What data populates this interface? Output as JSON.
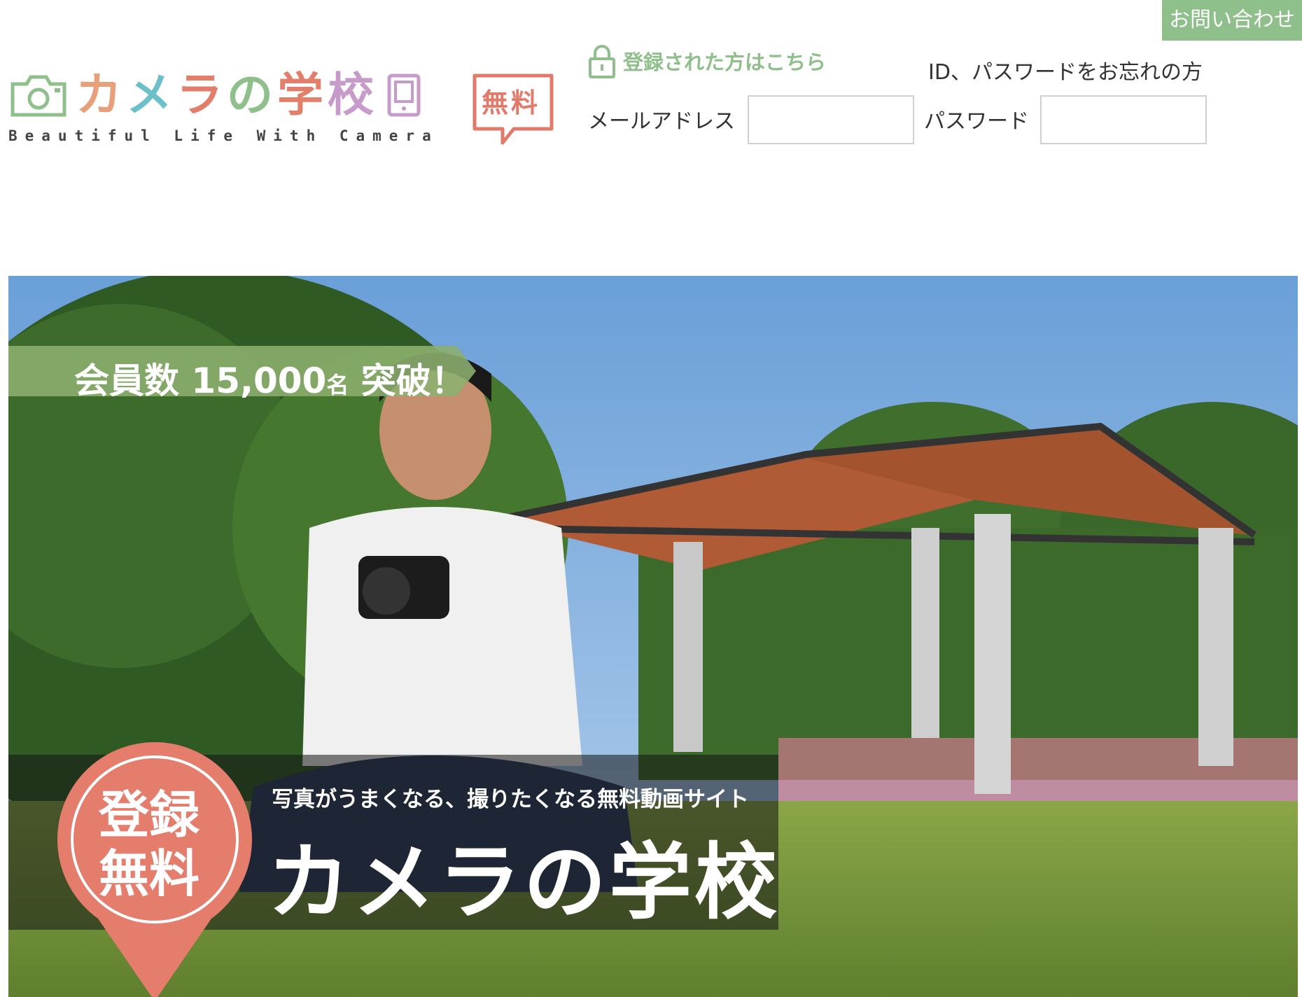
{
  "header": {
    "contact_label": "お問い合わせ",
    "logo": {
      "title_chars": [
        "カ",
        "メ",
        "ラ",
        "の",
        "学",
        "校"
      ],
      "title_colors": [
        "#e8a07a",
        "#6bbfc9",
        "#e27f6b",
        "#8fbf8a",
        "#e27f6b",
        "#c79bc9"
      ],
      "subtitle": "Beautiful Life With Camera",
      "badge_label": "無料",
      "accent_color": "#e07a6a"
    },
    "login_link_label": "登録された方はこちら",
    "forgot_label": "ID、パスワードをお忘れの方",
    "email_label": "メールアドレス",
    "email_value": "",
    "password_label": "パスワード",
    "password_value": ""
  },
  "hero": {
    "members_prefix": "会員数 15,000",
    "members_unit": "名",
    "members_suffix": " 突破！",
    "badge_line1": "登録",
    "badge_line2": "無料",
    "tagline": "写真がうまくなる、撮りたくなる無料動画サイト",
    "title": "カメラの学校"
  },
  "colors": {
    "green": "#8fbf8a",
    "coral": "#e57d6c"
  }
}
